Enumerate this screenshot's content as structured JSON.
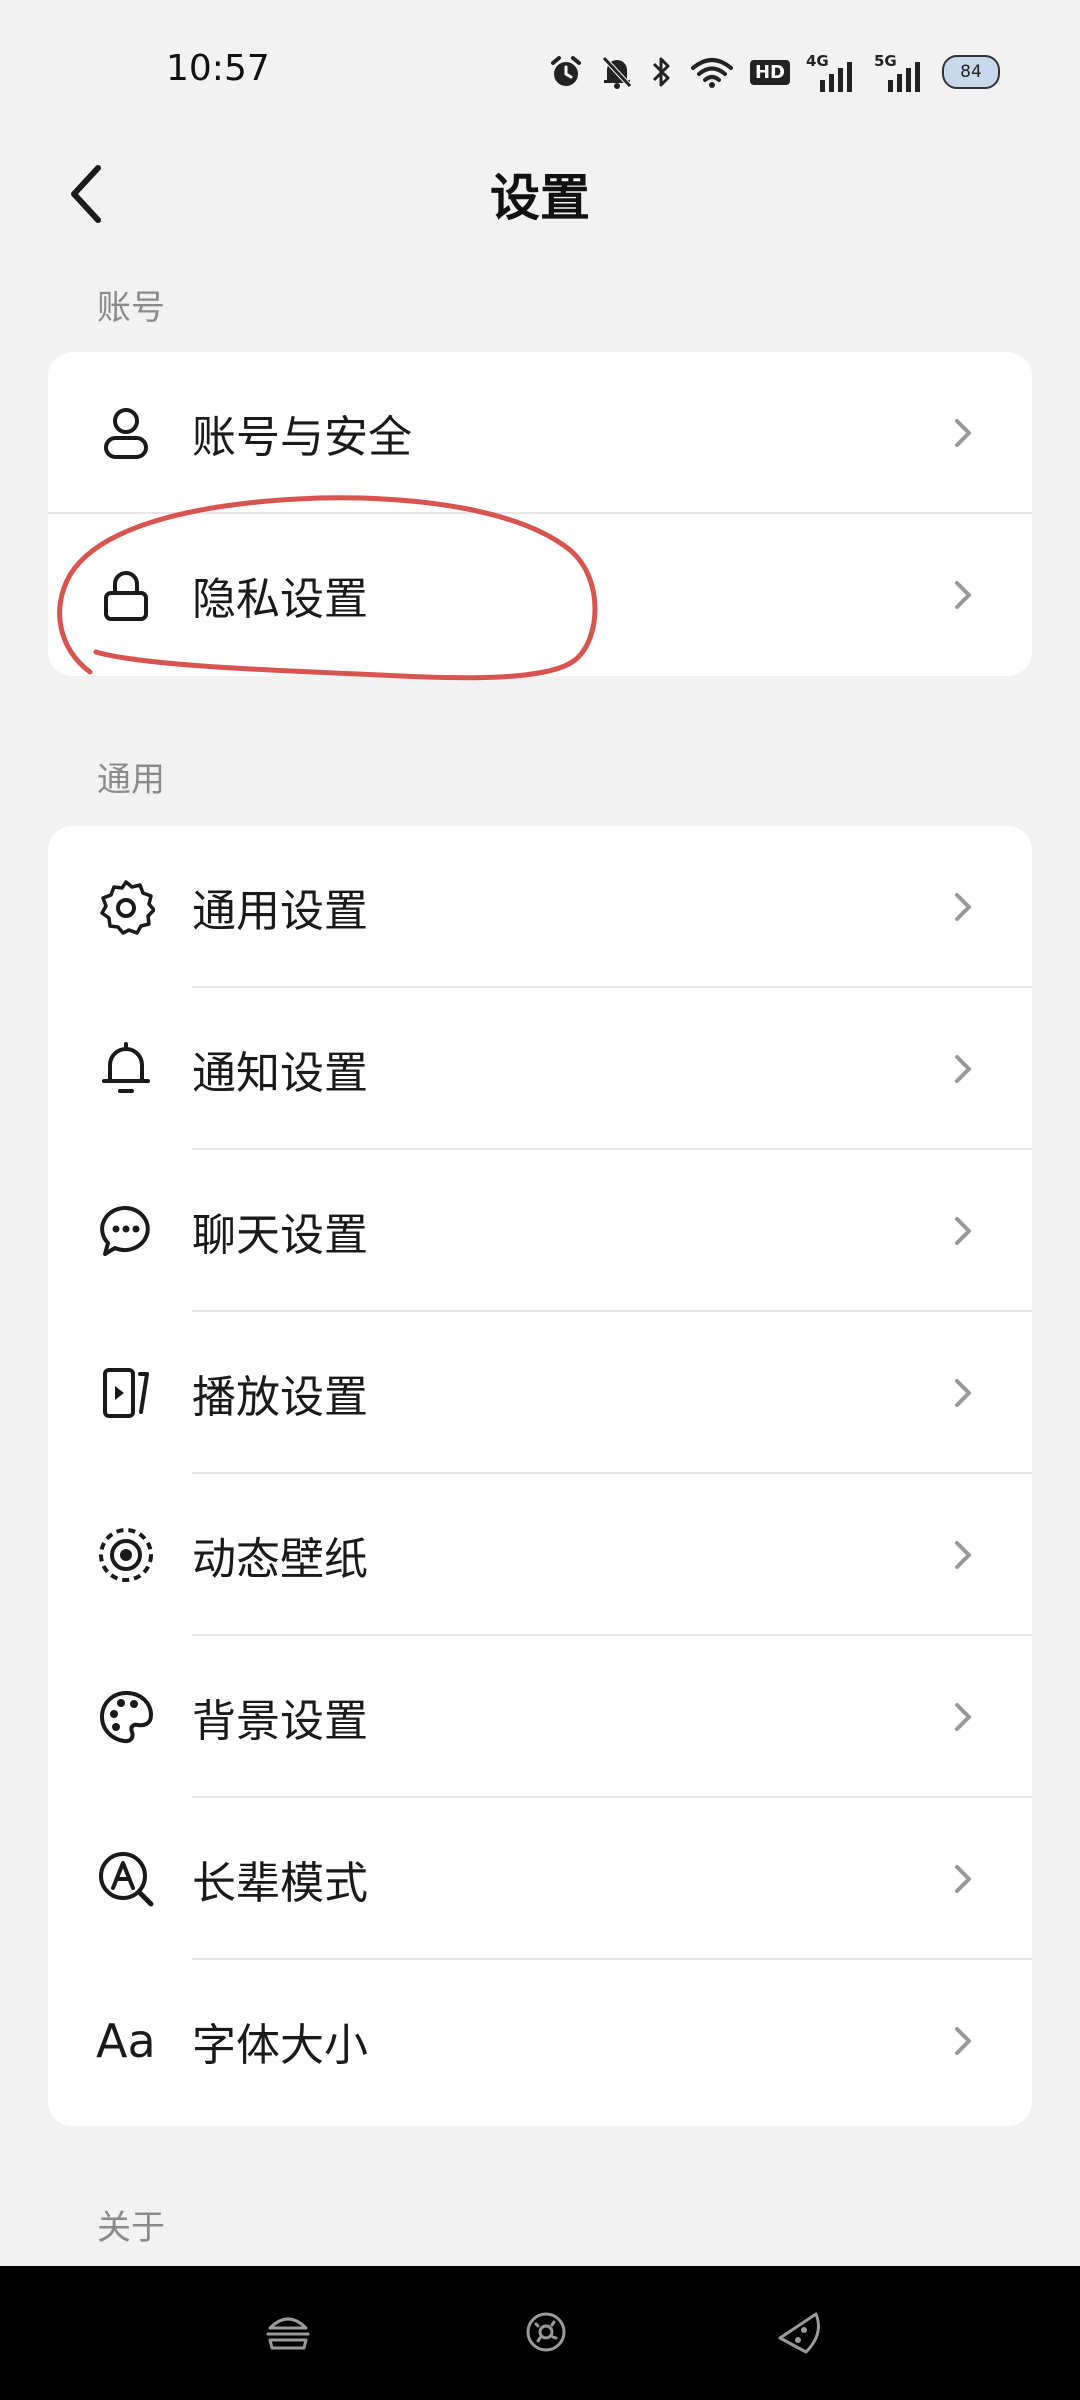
{
  "status_bar": {
    "time": "10:57",
    "hd_badge": "HD",
    "signal_1": "4G",
    "signal_2": "5G",
    "battery": "84",
    "icons": [
      "alarm-icon",
      "mute-bell-icon",
      "bluetooth-icon",
      "wifi-icon",
      "hd-icon",
      "signal-4g-icon",
      "signal-5g-icon",
      "battery-icon"
    ]
  },
  "header": {
    "title": "设置",
    "back_icon": "chevron-left-icon"
  },
  "sections": {
    "account": {
      "title": "账号",
      "items": [
        {
          "label": "账号与安全",
          "icon": "person-icon"
        },
        {
          "label": "隐私设置",
          "icon": "lock-icon"
        }
      ]
    },
    "general": {
      "title": "通用",
      "items": [
        {
          "label": "通用设置",
          "icon": "gear-icon"
        },
        {
          "label": "通知设置",
          "icon": "bell-icon"
        },
        {
          "label": "聊天设置",
          "icon": "chat-bubble-icon"
        },
        {
          "label": "播放设置",
          "icon": "play-screen-icon"
        },
        {
          "label": "动态壁纸",
          "icon": "dynamic-wallpaper-icon"
        },
        {
          "label": "背景设置",
          "icon": "palette-icon"
        },
        {
          "label": "长辈模式",
          "icon": "elder-mode-icon"
        },
        {
          "label": "字体大小",
          "icon": "font-size-icon",
          "icon_text": "Aa"
        }
      ]
    },
    "about": {
      "title": "关于"
    }
  },
  "annotation": {
    "color": "#d9534f",
    "note": "red hand-drawn circle around privacy settings row"
  },
  "nav_bar": {
    "icons": [
      "burger-icon",
      "donut-icon",
      "pizza-slice-icon"
    ]
  }
}
